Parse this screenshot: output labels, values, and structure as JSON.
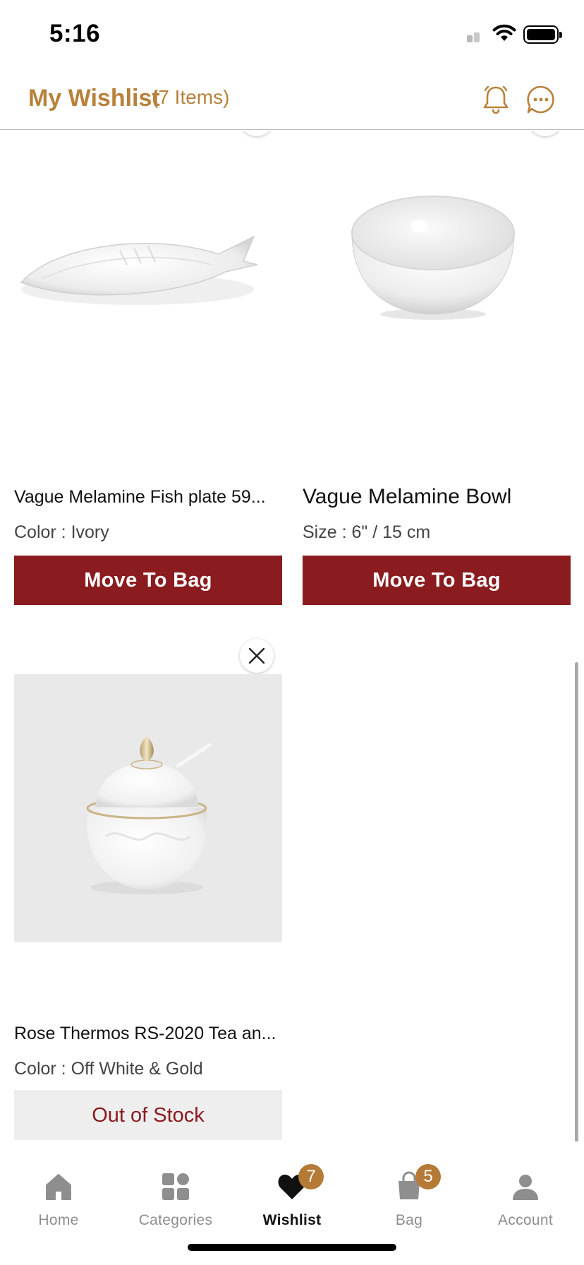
{
  "status_bar": {
    "time": "5:16"
  },
  "header": {
    "title": "My Wishlist",
    "count": "(7 Items)"
  },
  "products": [
    {
      "name": "Vague Melamine Fish plate 59...",
      "meta": "Color : Ivory",
      "action": "Move To Bag"
    },
    {
      "name": "Vague Melamine Bowl",
      "meta": "Size : 6\" / 15 cm",
      "action": "Move To Bag"
    },
    {
      "name": "Rose Thermos RS-2020 Tea an...",
      "meta": "Color : Off White & Gold",
      "action": "Out of Stock"
    }
  ],
  "tabs": [
    {
      "label": "Home",
      "icon": "home-icon"
    },
    {
      "label": "Categories",
      "icon": "categories-icon"
    },
    {
      "label": "Wishlist",
      "icon": "heart-icon",
      "badge": "7",
      "active": true
    },
    {
      "label": "Bag",
      "icon": "bag-icon",
      "badge": "5"
    },
    {
      "label": "Account",
      "icon": "account-icon"
    }
  ],
  "colors": {
    "brand_gold": "#b8813b",
    "button_red": "#8a1b1f",
    "badge": "#b57a35"
  }
}
